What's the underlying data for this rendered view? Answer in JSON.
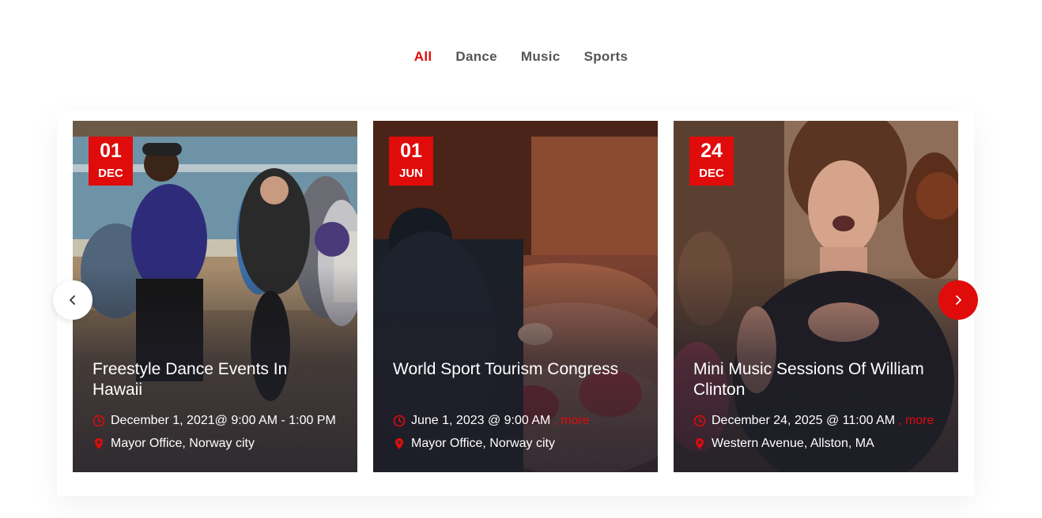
{
  "filters": {
    "items": [
      {
        "label": "All",
        "active": true
      },
      {
        "label": "Dance",
        "active": false
      },
      {
        "label": "Music",
        "active": false
      },
      {
        "label": "Sports",
        "active": false
      }
    ]
  },
  "colors": {
    "accent": "#e00b0b",
    "tab_inactive": "#555555",
    "text_light": "#ffffff"
  },
  "events": [
    {
      "day": "01",
      "month": "DEC",
      "title": "Freestyle Dance Events In Hawaii",
      "time": "December 1, 2021@ 9:00 AM - 1:00 PM",
      "more": "",
      "location": "Mayor Office, Norway city"
    },
    {
      "day": "01",
      "month": "JUN",
      "title": "World Sport Tourism Congress",
      "time": "June 1, 2023 @ 9:00 AM",
      "more": ", more",
      "location": "Mayor Office, Norway city"
    },
    {
      "day": "24",
      "month": "DEC",
      "title": "Mini Music Sessions Of William Clinton",
      "time": "December 24, 2025 @ 11:00 AM",
      "more": ", more",
      "location": "Western Avenue, Allston, MA"
    }
  ],
  "icons": {
    "time": "clock-icon",
    "location": "map-pin-icon",
    "prev": "chevron-left-icon",
    "next": "chevron-right-icon"
  }
}
